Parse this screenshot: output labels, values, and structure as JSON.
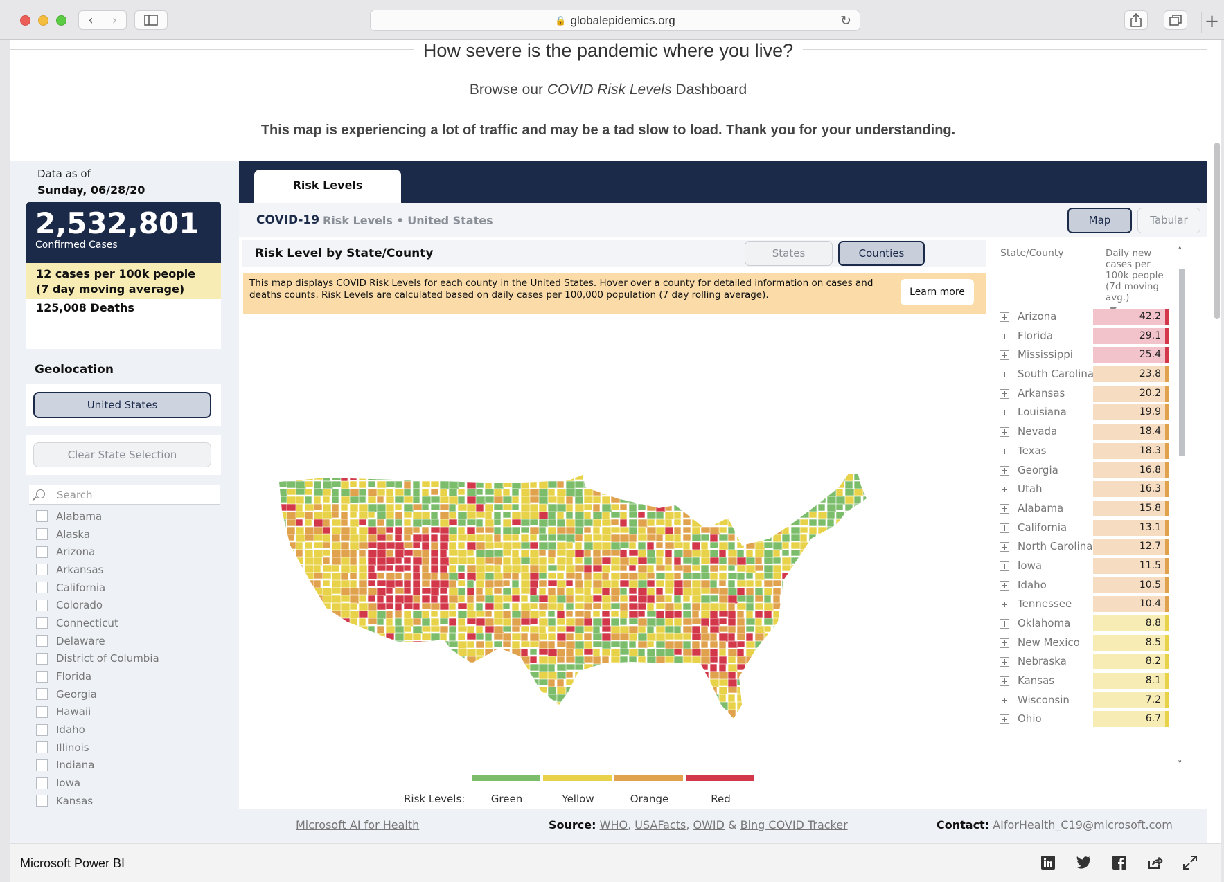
{
  "browser": {
    "url": "globalepidemics.org"
  },
  "hero": {
    "title": "How severe is the pandemic where you live?",
    "subtitle_prefix": "Browse our ",
    "subtitle_em": "COVID Risk Levels",
    "subtitle_suffix": " Dashboard",
    "notice": "This map is experiencing a lot of traffic and may be a tad slow to load. Thank you for your understanding."
  },
  "summary": {
    "data_as_of_label": "Data as of",
    "date": "Sunday, 06/28/20",
    "confirmed_cases": "2,532,801",
    "confirmed_label": "Confirmed Cases",
    "cases_per_100k": "12 cases per 100k people (7 day moving average)",
    "deaths": "125,008 Deaths"
  },
  "geolocation": {
    "label": "Geolocation",
    "selected": "United States",
    "clear_button": "Clear State Selection",
    "search_placeholder": "Search",
    "states": [
      "Alabama",
      "Alaska",
      "Arizona",
      "Arkansas",
      "California",
      "Colorado",
      "Connecticut",
      "Delaware",
      "District of Columbia",
      "Florida",
      "Georgia",
      "Hawaii",
      "Idaho",
      "Illinois",
      "Indiana",
      "Iowa",
      "Kansas"
    ]
  },
  "report": {
    "tab": "Risk Levels",
    "sub_covid": "COVID-19",
    "sub_rest": "Risk Levels • United States",
    "view_map": "Map",
    "view_tabular": "Tabular",
    "section_title": "Risk Level by State/County",
    "btn_states": "States",
    "btn_counties": "Counties",
    "info": "This map displays COVID Risk Levels for each county in the United States. Hover over a county for detailed information on cases and deaths counts. Risk Levels are calculated based on daily cases per 100,000 population (7 day rolling average).",
    "learn_more": "Learn more"
  },
  "legend": {
    "label": "Risk Levels:",
    "items": [
      {
        "name": "Green",
        "color": "#7cbd6b"
      },
      {
        "name": "Yellow",
        "color": "#e8d24a"
      },
      {
        "name": "Orange",
        "color": "#e0a24c"
      },
      {
        "name": "Red",
        "color": "#d2384a"
      }
    ]
  },
  "table": {
    "col_state": "State/County",
    "col_metric": "Daily new cases per 100k people (7d moving avg.)",
    "rows": [
      {
        "name": "Arizona",
        "value": "42.2",
        "level": "red"
      },
      {
        "name": "Florida",
        "value": "29.1",
        "level": "red"
      },
      {
        "name": "Mississippi",
        "value": "25.4",
        "level": "red"
      },
      {
        "name": "South Carolina",
        "value": "23.8",
        "level": "orange"
      },
      {
        "name": "Arkansas",
        "value": "20.2",
        "level": "orange"
      },
      {
        "name": "Louisiana",
        "value": "19.9",
        "level": "orange"
      },
      {
        "name": "Nevada",
        "value": "18.4",
        "level": "orange"
      },
      {
        "name": "Texas",
        "value": "18.3",
        "level": "orange"
      },
      {
        "name": "Georgia",
        "value": "16.8",
        "level": "orange"
      },
      {
        "name": "Utah",
        "value": "16.3",
        "level": "orange"
      },
      {
        "name": "Alabama",
        "value": "15.8",
        "level": "orange"
      },
      {
        "name": "California",
        "value": "13.1",
        "level": "orange"
      },
      {
        "name": "North Carolina",
        "value": "12.7",
        "level": "orange"
      },
      {
        "name": "Iowa",
        "value": "11.5",
        "level": "orange"
      },
      {
        "name": "Idaho",
        "value": "10.5",
        "level": "orange"
      },
      {
        "name": "Tennessee",
        "value": "10.4",
        "level": "orange"
      },
      {
        "name": "Oklahoma",
        "value": "8.8",
        "level": "yellow"
      },
      {
        "name": "New Mexico",
        "value": "8.5",
        "level": "yellow"
      },
      {
        "name": "Nebraska",
        "value": "8.2",
        "level": "yellow"
      },
      {
        "name": "Kansas",
        "value": "8.1",
        "level": "yellow"
      },
      {
        "name": "Wisconsin",
        "value": "7.2",
        "level": "yellow"
      },
      {
        "name": "Ohio",
        "value": "6.7",
        "level": "yellow"
      }
    ]
  },
  "footer": {
    "ms_link": "Microsoft AI for Health",
    "source_label": "Source:",
    "source_links": [
      "WHO",
      "USAFacts",
      "OWID",
      "Bing COVID Tracker"
    ],
    "contact_label": "Contact:",
    "contact_email": "AIforHealth_C19@microsoft.com"
  },
  "powerbi": {
    "label": "Microsoft Power BI"
  },
  "colors": {
    "navy": "#1c2a4a",
    "red_cell": "#f2c3cb",
    "red_tick": "#d2384a",
    "orange_cell": "#f6dcc0",
    "orange_tick": "#e0a24c",
    "yellow_cell": "#f7ecb4",
    "yellow_tick": "#e8d24a"
  }
}
